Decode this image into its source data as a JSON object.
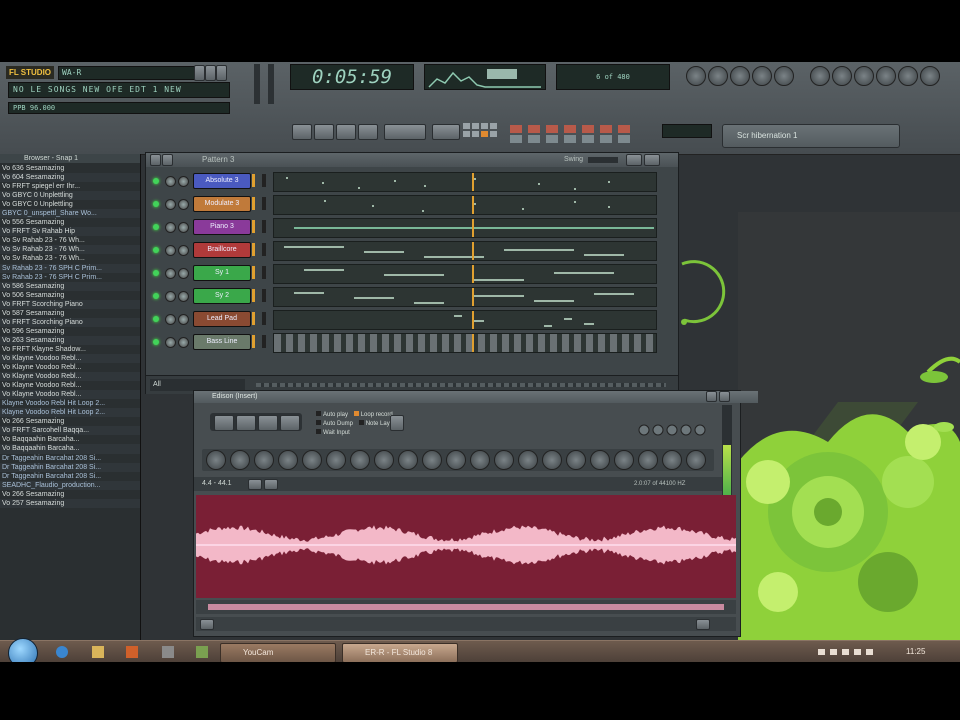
{
  "app": {
    "logo_text": "FL STUDIO",
    "song_name": "WA-R",
    "hint_bar": "NO LE SONGS NEW OFE EDT 1 NEW",
    "sub_status": "PPB 96.000",
    "time_display": "0:05:59",
    "small_display": "6 of 480",
    "preset_label": "Scr hibernation 1"
  },
  "browser": {
    "header": "Browser - Snap 1",
    "items": [
      {
        "text": "Vo 636 Sesamazing",
        "kind": "folder"
      },
      {
        "text": "Vo 604 Sesamazing",
        "kind": "folder"
      },
      {
        "text": "Vo FRFT spiegel err Ihr...",
        "kind": "folder"
      },
      {
        "text": "Vo GBYC 0 Unplettling",
        "kind": "folder"
      },
      {
        "text": "Vo GBYC 0 Unplettling",
        "kind": "folder"
      },
      {
        "text": "GBYC 0_unspettl_Share Wo...",
        "kind": "file"
      },
      {
        "text": "Vo 556 Sesamazing",
        "kind": "folder"
      },
      {
        "text": "Vo FRFT Sv Rahab Hip",
        "kind": "folder"
      },
      {
        "text": "Vo Sv Rahab 23 - 76 Wh...",
        "kind": "folder"
      },
      {
        "text": "Vo Sv Rahab 23 - 76 Wh...",
        "kind": "folder"
      },
      {
        "text": "Vo Sv Rahab 23 - 76 Wh...",
        "kind": "folder"
      },
      {
        "text": "Sv Rahab 23 - 76 SPH C Prim...",
        "kind": "file"
      },
      {
        "text": "Sv Rahab 23 - 76 SPH C Prim...",
        "kind": "file"
      },
      {
        "text": "Vo 586 Sesamazing",
        "kind": "folder"
      },
      {
        "text": "Vo 506 Sesamazing",
        "kind": "folder"
      },
      {
        "text": "Vo FRFT Scorching Piano",
        "kind": "folder"
      },
      {
        "text": "Vo 587 Sesamazing",
        "kind": "folder"
      },
      {
        "text": "Vo FRFT Scorching Piano",
        "kind": "folder"
      },
      {
        "text": "Vo 596 Sesamazing",
        "kind": "folder"
      },
      {
        "text": "Vo 263 Sesamazing",
        "kind": "folder"
      },
      {
        "text": "Vo FRFT Klayne Shadow...",
        "kind": "folder"
      },
      {
        "text": "Vo Klayne Voodoo Rebl...",
        "kind": "folder"
      },
      {
        "text": "Vo Klayne Voodoo Rebl...",
        "kind": "folder"
      },
      {
        "text": "Vo Klayne Voodoo Rebl...",
        "kind": "folder"
      },
      {
        "text": "Vo Klayne Voodoo Rebl...",
        "kind": "folder"
      },
      {
        "text": "Vo Klayne Voodoo Rebl...",
        "kind": "folder"
      },
      {
        "text": "Klayne Voodoo Rebl Hit Loop 2...",
        "kind": "file"
      },
      {
        "text": "Klayne Voodoo Rebl Hit Loop 2...",
        "kind": "file"
      },
      {
        "text": "Vo 266 Sesamazing",
        "kind": "folder"
      },
      {
        "text": "Vo FRFT Sarcohell Baqqa...",
        "kind": "folder"
      },
      {
        "text": "Vo Baqqaahin Barcaha...",
        "kind": "folder"
      },
      {
        "text": "Vo Baqqaahin Barcaha...",
        "kind": "folder"
      },
      {
        "text": "Dr Taggeahin Barcahat 208 Si...",
        "kind": "file"
      },
      {
        "text": "Dr Taggeahin Barcahat 208 Si...",
        "kind": "file"
      },
      {
        "text": "Dr Taggeahin Barcahat 208 Si...",
        "kind": "file"
      },
      {
        "text": "SEADHC_Flaudio_production...",
        "kind": "file"
      },
      {
        "text": "Vo 266 Sesamazing",
        "kind": "folder"
      },
      {
        "text": "Vo 257 Sesamazing",
        "kind": "folder"
      }
    ]
  },
  "sequencer": {
    "title": "Pattern 3",
    "swing_label": "Swing",
    "footer_label": "All",
    "channels": [
      {
        "name": "Absolute 3",
        "color": "#4a5ac0"
      },
      {
        "name": "Modulate 3",
        "color": "#c07a3a"
      },
      {
        "name": "Piano 3",
        "color": "#8a3a9a"
      },
      {
        "name": "Braillcore",
        "color": "#b03a3a"
      },
      {
        "name": "Sy 1",
        "color": "#3aa84a"
      },
      {
        "name": "Sy 2",
        "color": "#3aa84a"
      },
      {
        "name": "Lead Pad",
        "color": "#8a4a32"
      },
      {
        "name": "Bass Line",
        "color": "#6a7a6a"
      }
    ]
  },
  "edison": {
    "title": "Edison (Insert)",
    "option_1": "Auto play",
    "option_2": "Loop record",
    "option_3": "Auto Dump",
    "option_4": "Note Layer",
    "option_5": "Wait Input",
    "position_label": "4.4 - 44.1",
    "info_label": "2.0:07 of 44100 HZ"
  },
  "taskbar": {
    "task_1": "YouCam",
    "task_2": "ER-R - FL Studio 8",
    "clock": "11:25"
  },
  "colors": {
    "waveform_bg": "#7a1f35",
    "waveform_fg": "#f3b8c8",
    "accent_green": "#7cc43a",
    "toolbar_bg": "#4f5559"
  }
}
